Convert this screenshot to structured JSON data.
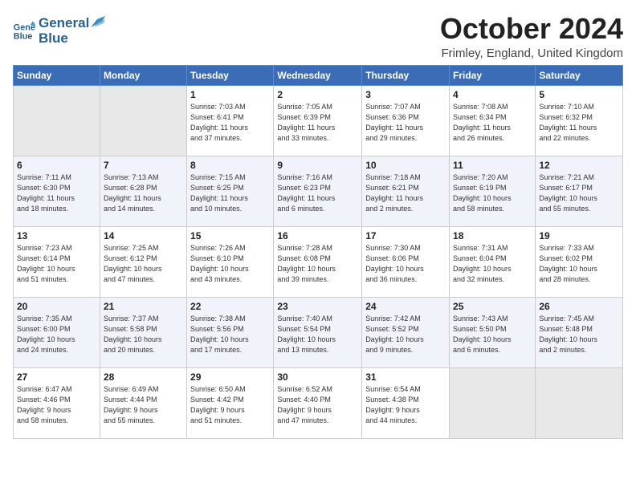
{
  "header": {
    "logo_line1": "General",
    "logo_line2": "Blue",
    "month_title": "October 2024",
    "location": "Frimley, England, United Kingdom"
  },
  "days_of_week": [
    "Sunday",
    "Monday",
    "Tuesday",
    "Wednesday",
    "Thursday",
    "Friday",
    "Saturday"
  ],
  "weeks": [
    [
      {
        "num": "",
        "detail": ""
      },
      {
        "num": "",
        "detail": ""
      },
      {
        "num": "1",
        "detail": "Sunrise: 7:03 AM\nSunset: 6:41 PM\nDaylight: 11 hours\nand 37 minutes."
      },
      {
        "num": "2",
        "detail": "Sunrise: 7:05 AM\nSunset: 6:39 PM\nDaylight: 11 hours\nand 33 minutes."
      },
      {
        "num": "3",
        "detail": "Sunrise: 7:07 AM\nSunset: 6:36 PM\nDaylight: 11 hours\nand 29 minutes."
      },
      {
        "num": "4",
        "detail": "Sunrise: 7:08 AM\nSunset: 6:34 PM\nDaylight: 11 hours\nand 26 minutes."
      },
      {
        "num": "5",
        "detail": "Sunrise: 7:10 AM\nSunset: 6:32 PM\nDaylight: 11 hours\nand 22 minutes."
      }
    ],
    [
      {
        "num": "6",
        "detail": "Sunrise: 7:11 AM\nSunset: 6:30 PM\nDaylight: 11 hours\nand 18 minutes."
      },
      {
        "num": "7",
        "detail": "Sunrise: 7:13 AM\nSunset: 6:28 PM\nDaylight: 11 hours\nand 14 minutes."
      },
      {
        "num": "8",
        "detail": "Sunrise: 7:15 AM\nSunset: 6:25 PM\nDaylight: 11 hours\nand 10 minutes."
      },
      {
        "num": "9",
        "detail": "Sunrise: 7:16 AM\nSunset: 6:23 PM\nDaylight: 11 hours\nand 6 minutes."
      },
      {
        "num": "10",
        "detail": "Sunrise: 7:18 AM\nSunset: 6:21 PM\nDaylight: 11 hours\nand 2 minutes."
      },
      {
        "num": "11",
        "detail": "Sunrise: 7:20 AM\nSunset: 6:19 PM\nDaylight: 10 hours\nand 58 minutes."
      },
      {
        "num": "12",
        "detail": "Sunrise: 7:21 AM\nSunset: 6:17 PM\nDaylight: 10 hours\nand 55 minutes."
      }
    ],
    [
      {
        "num": "13",
        "detail": "Sunrise: 7:23 AM\nSunset: 6:14 PM\nDaylight: 10 hours\nand 51 minutes."
      },
      {
        "num": "14",
        "detail": "Sunrise: 7:25 AM\nSunset: 6:12 PM\nDaylight: 10 hours\nand 47 minutes."
      },
      {
        "num": "15",
        "detail": "Sunrise: 7:26 AM\nSunset: 6:10 PM\nDaylight: 10 hours\nand 43 minutes."
      },
      {
        "num": "16",
        "detail": "Sunrise: 7:28 AM\nSunset: 6:08 PM\nDaylight: 10 hours\nand 39 minutes."
      },
      {
        "num": "17",
        "detail": "Sunrise: 7:30 AM\nSunset: 6:06 PM\nDaylight: 10 hours\nand 36 minutes."
      },
      {
        "num": "18",
        "detail": "Sunrise: 7:31 AM\nSunset: 6:04 PM\nDaylight: 10 hours\nand 32 minutes."
      },
      {
        "num": "19",
        "detail": "Sunrise: 7:33 AM\nSunset: 6:02 PM\nDaylight: 10 hours\nand 28 minutes."
      }
    ],
    [
      {
        "num": "20",
        "detail": "Sunrise: 7:35 AM\nSunset: 6:00 PM\nDaylight: 10 hours\nand 24 minutes."
      },
      {
        "num": "21",
        "detail": "Sunrise: 7:37 AM\nSunset: 5:58 PM\nDaylight: 10 hours\nand 20 minutes."
      },
      {
        "num": "22",
        "detail": "Sunrise: 7:38 AM\nSunset: 5:56 PM\nDaylight: 10 hours\nand 17 minutes."
      },
      {
        "num": "23",
        "detail": "Sunrise: 7:40 AM\nSunset: 5:54 PM\nDaylight: 10 hours\nand 13 minutes."
      },
      {
        "num": "24",
        "detail": "Sunrise: 7:42 AM\nSunset: 5:52 PM\nDaylight: 10 hours\nand 9 minutes."
      },
      {
        "num": "25",
        "detail": "Sunrise: 7:43 AM\nSunset: 5:50 PM\nDaylight: 10 hours\nand 6 minutes."
      },
      {
        "num": "26",
        "detail": "Sunrise: 7:45 AM\nSunset: 5:48 PM\nDaylight: 10 hours\nand 2 minutes."
      }
    ],
    [
      {
        "num": "27",
        "detail": "Sunrise: 6:47 AM\nSunset: 4:46 PM\nDaylight: 9 hours\nand 58 minutes."
      },
      {
        "num": "28",
        "detail": "Sunrise: 6:49 AM\nSunset: 4:44 PM\nDaylight: 9 hours\nand 55 minutes."
      },
      {
        "num": "29",
        "detail": "Sunrise: 6:50 AM\nSunset: 4:42 PM\nDaylight: 9 hours\nand 51 minutes."
      },
      {
        "num": "30",
        "detail": "Sunrise: 6:52 AM\nSunset: 4:40 PM\nDaylight: 9 hours\nand 47 minutes."
      },
      {
        "num": "31",
        "detail": "Sunrise: 6:54 AM\nSunset: 4:38 PM\nDaylight: 9 hours\nand 44 minutes."
      },
      {
        "num": "",
        "detail": ""
      },
      {
        "num": "",
        "detail": ""
      }
    ]
  ]
}
